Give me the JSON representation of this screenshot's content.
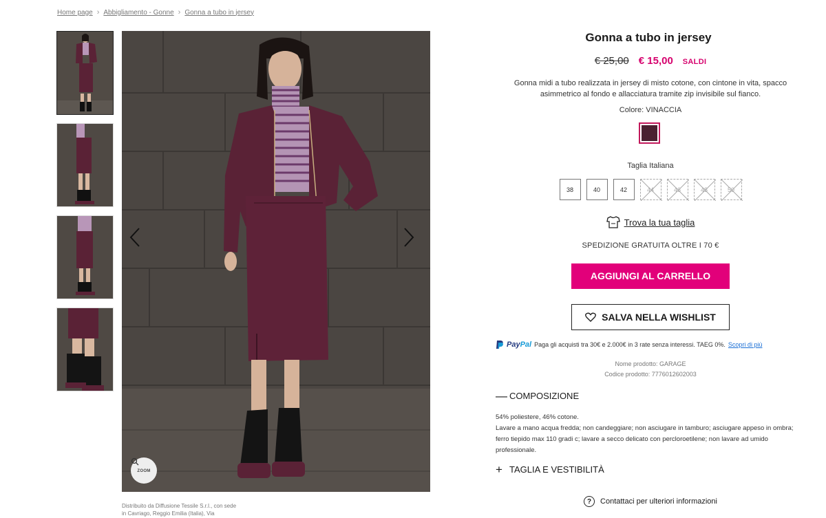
{
  "breadcrumb": [
    "Home page",
    "Abbigliamento - Gonne",
    "Gonna a tubo in jersey"
  ],
  "gallery": {
    "thumbnail_count": 4,
    "zoom_label": "ZOOM",
    "distributed_by": "Distribuito da Diffusione Tessile S.r.l., con sede in Cavriago, Reggio Emilia (Italia), Via"
  },
  "product": {
    "title": "Gonna a tubo in jersey",
    "old_price": "€ 25,00",
    "new_price": "€ 15,00",
    "sale_badge": "SALDI",
    "description": "Gonna midi a tubo realizzata in jersey di misto cotone, con cintone in vita, spacco asimmetrico al fondo e allacciatura tramite zip invisibile sul fianco.",
    "color_label": "Colore: VINACCIA",
    "swatch_color": "#4a2030",
    "size_label": "Taglia Italiana",
    "sizes": [
      {
        "label": "38",
        "available": true
      },
      {
        "label": "40",
        "available": true
      },
      {
        "label": "42",
        "available": true
      },
      {
        "label": "44",
        "available": false
      },
      {
        "label": "46",
        "available": false
      },
      {
        "label": "48",
        "available": false
      },
      {
        "label": "50",
        "available": false
      }
    ],
    "size_guide": "Trova la tua taglia",
    "shipping": "SPEDIZIONE GRATUITA OLTRE I 70 €",
    "add_to_cart": "AGGIUNGI AL CARRELLO",
    "wishlist": "SALVA NELLA WISHLIST",
    "paypal": {
      "logo_pay": "Pay",
      "logo_pal": "Pal",
      "text": "Paga gli acquisti tra 30€ e 2.000€ in 3 rate senza interessi. TAEG 0%.",
      "link": "Scopri di più"
    },
    "name_line": "Nome prodotto: GARAGE",
    "code_line": "Codice prodotto:  7776012602003",
    "composition": {
      "title": "COMPOSIZIONE",
      "line1": "54% poliestere, 46% cotone.",
      "line2": "Lavare a mano acqua fredda; non candeggiare; non asciugare in tamburo; asciugare appeso in ombra; ferro tiepido max 110 gradi c; lavare a secco delicato con percloroetilene; non lavare ad umido professionale."
    },
    "fit_title": "TAGLIA E VESTIBILITÀ",
    "contact": "Contattaci per ulteriori informazioni"
  },
  "colors": {
    "accent": "#e2007a",
    "sale": "#d6006d",
    "garment": "#5a2236",
    "background_photo": "#4a4541"
  }
}
